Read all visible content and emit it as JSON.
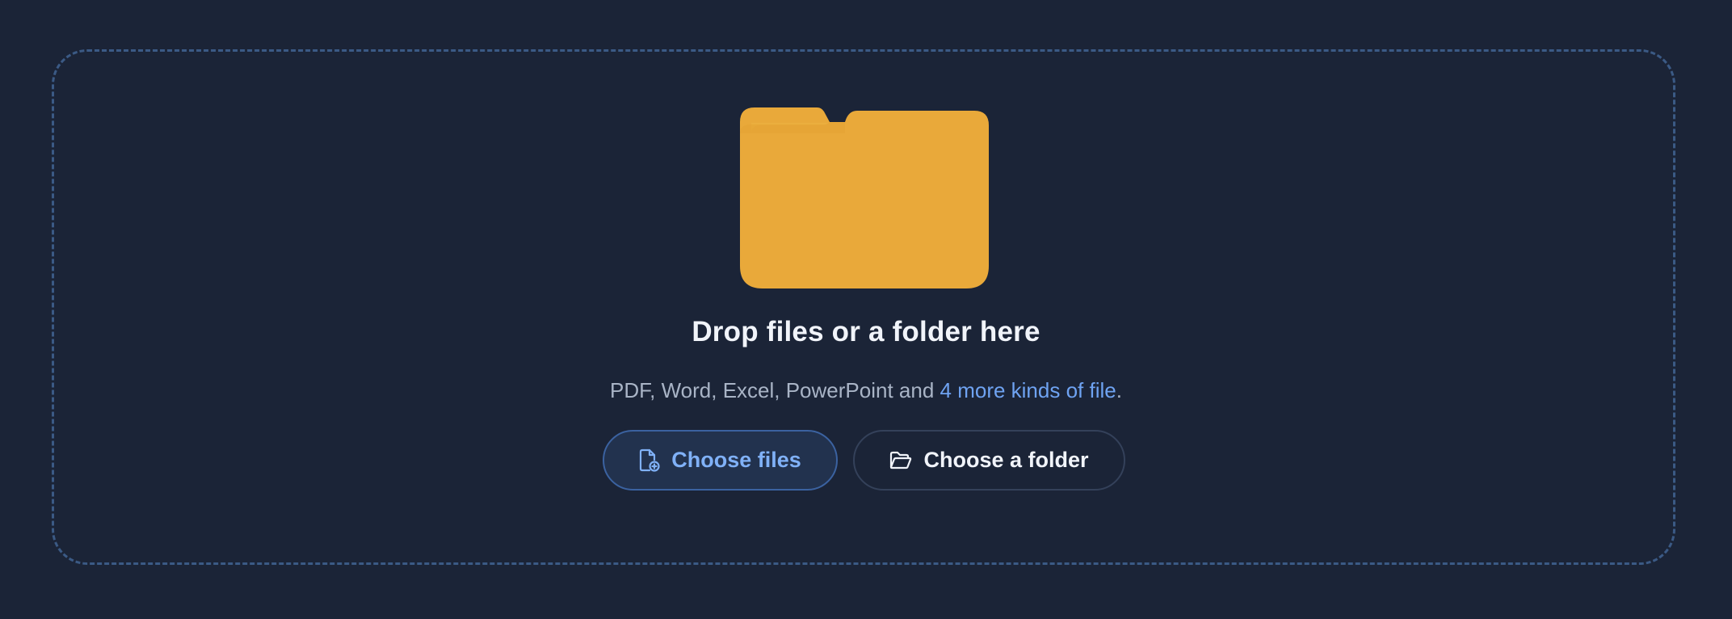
{
  "dropzone": {
    "title": "Drop files or a folder here",
    "formats_text": "PDF, Word, Excel, PowerPoint and ",
    "more_link": "4 more kinds of file",
    "formats_end": ".",
    "folder_icon": "folder-icon"
  },
  "actions": {
    "choose_files_label": "Choose files",
    "choose_files_icon": "file-add-icon",
    "choose_folder_label": "Choose a folder",
    "choose_folder_icon": "folder-open-icon"
  },
  "colors": {
    "background": "#1b2437",
    "dropzone_border": "#3b5a85",
    "folder": "#e9a93a",
    "link": "#6fa3f2",
    "primary_button_text": "#80b1f7"
  }
}
